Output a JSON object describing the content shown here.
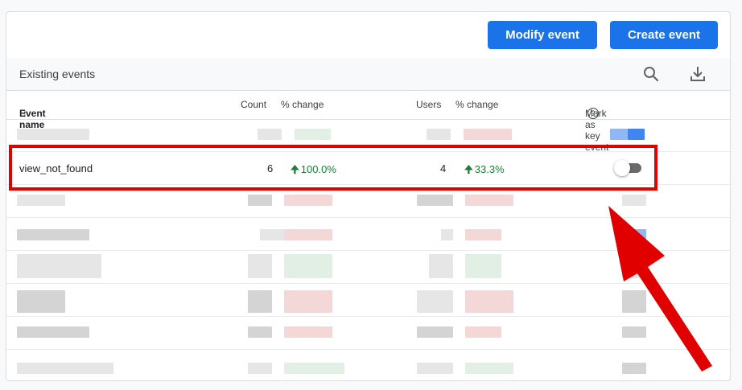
{
  "toolbar": {
    "modify_label": "Modify event",
    "create_label": "Create event"
  },
  "section": {
    "title": "Existing events"
  },
  "icons": {
    "search": "search-icon",
    "download": "download-icon",
    "sort": "arrow-up-icon",
    "help": "help-circle-icon",
    "trend": "arrow-up-icon"
  },
  "table": {
    "headers": {
      "event_name": "Event name",
      "count": "Count",
      "count_change": "% change",
      "users": "Users",
      "users_change": "% change",
      "key_event": "Mark as key event",
      "help_glyph": "?"
    },
    "visible_row": {
      "event_name": "view_not_found",
      "count": "6",
      "count_change": "100.0%",
      "users": "4",
      "users_change": "33.3%",
      "key_event_on": false
    }
  },
  "colors": {
    "primary_button": "#1a73e8",
    "positive_change": "#188038",
    "annotation": "#e00000"
  }
}
